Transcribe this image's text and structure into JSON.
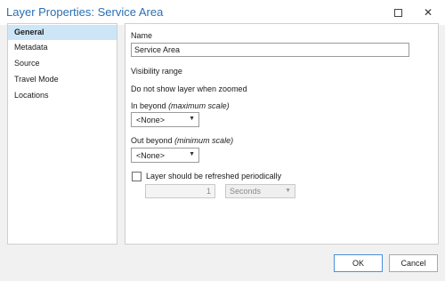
{
  "window": {
    "title": "Layer Properties: Service Area",
    "maximize_icon": "maximize-icon",
    "close_icon": "close-icon",
    "close_glyph": "✕"
  },
  "nav": {
    "items": [
      {
        "label": "General",
        "active": true
      },
      {
        "label": "Metadata",
        "active": false
      },
      {
        "label": "Source",
        "active": false
      },
      {
        "label": "Travel Mode",
        "active": false
      },
      {
        "label": "Locations",
        "active": false
      }
    ]
  },
  "general": {
    "name_label": "Name",
    "name_value": "Service Area",
    "visibility_range_label": "Visibility range",
    "do_not_show_label": "Do not show layer when zoomed",
    "in_beyond_label": "In beyond",
    "in_beyond_hint": "(maximum scale)",
    "in_beyond_value": "<None>",
    "out_beyond_label": "Out beyond",
    "out_beyond_hint": "(minimum scale)",
    "out_beyond_value": "<None>",
    "refresh_label": "Layer should be refreshed periodically",
    "refresh_checked": false,
    "refresh_interval": "1",
    "refresh_units": "Seconds",
    "caret_glyph": "▼"
  },
  "footer": {
    "ok_label": "OK",
    "cancel_label": "Cancel"
  },
  "colors": {
    "title": "#2b6fb1",
    "nav_active": "#cde6f7",
    "window_bg": "#f1f1f1"
  }
}
